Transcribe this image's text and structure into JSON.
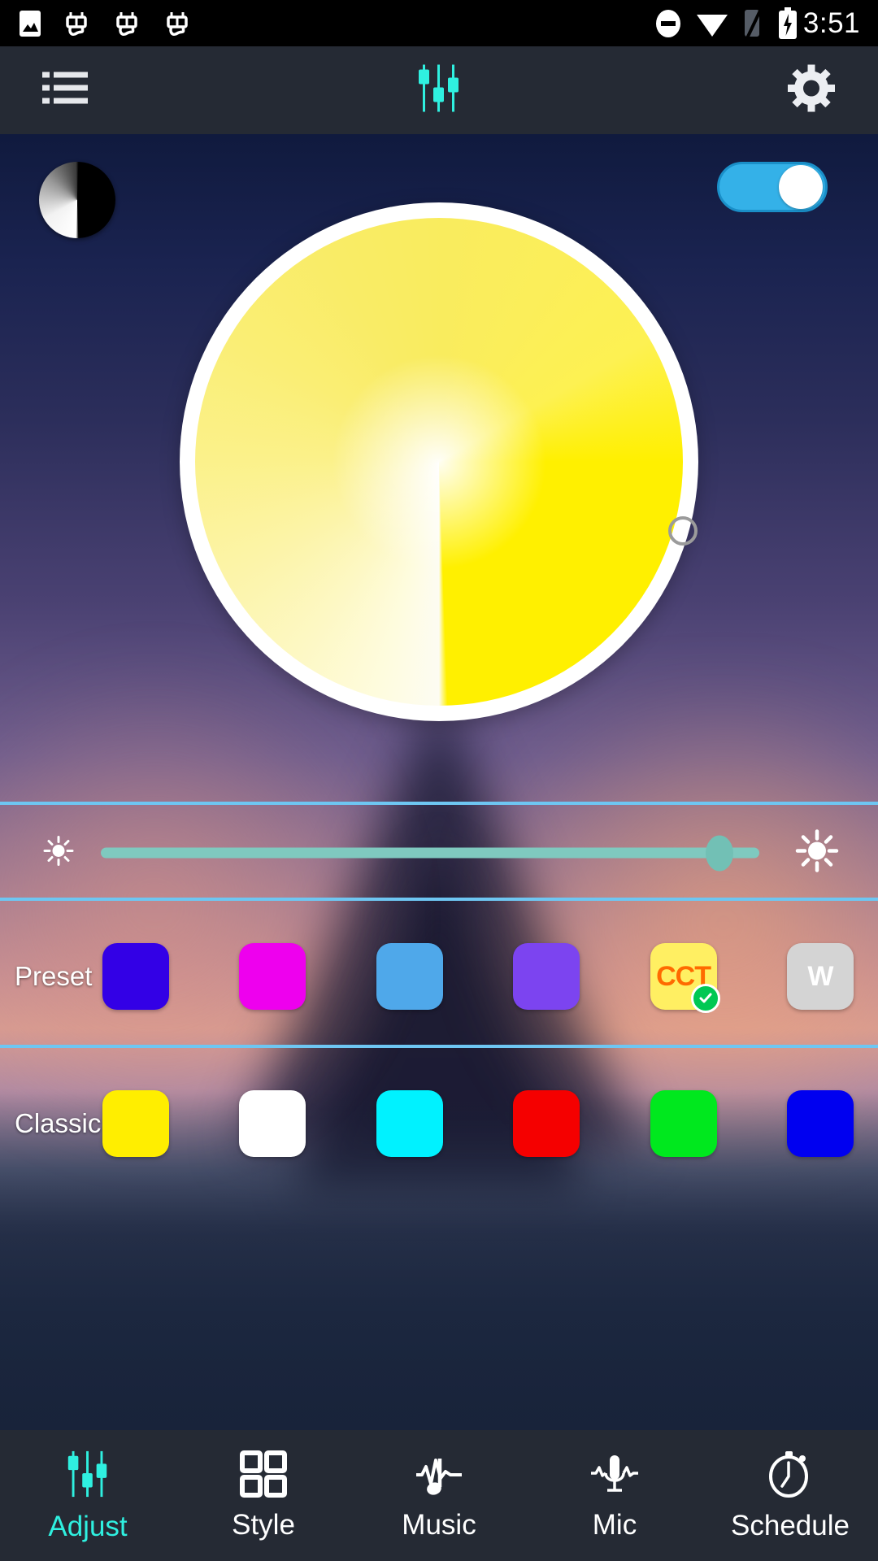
{
  "status_bar": {
    "time": "3:51",
    "left_icons": [
      "image-icon",
      "bug-icon",
      "bug-icon",
      "bug-icon"
    ],
    "right_icons": [
      "do-not-disturb-icon",
      "wifi-icon",
      "signal-off-icon",
      "battery-charging-icon"
    ]
  },
  "app_bar": {
    "menu_icon": "list-menu-icon",
    "title_icon": "sliders-icon",
    "settings_icon": "gear-icon",
    "accent_color": "#2ff0e0"
  },
  "main": {
    "preview_bubble": "color-preview-bubble",
    "power_toggle": {
      "state": "on",
      "track_color": "#34b1e8",
      "knob_color": "#ffffff"
    },
    "color_wheel": {
      "name": "cct-color-wheel",
      "mode": "CCT",
      "hot_color": "#fff000",
      "cool_color": "#ffffff",
      "handle_position": "right",
      "ring_color": "#ffffff"
    },
    "brightness": {
      "min_icon": "sun-small-icon",
      "max_icon": "sun-large-icon",
      "value_percent": 94,
      "track_color": "#7fc9bf",
      "knob_color": "#72c0b5"
    },
    "preset": {
      "label": "Preset",
      "swatches": [
        {
          "name": "preset-blue-violet",
          "color": "#3300e6",
          "text": "",
          "selected": false
        },
        {
          "name": "preset-magenta",
          "color": "#ee00ee",
          "text": "",
          "selected": false
        },
        {
          "name": "preset-light-blue",
          "color": "#4fa8ea",
          "text": "",
          "selected": false
        },
        {
          "name": "preset-purple",
          "color": "#7c44f0",
          "text": "",
          "selected": false
        },
        {
          "name": "preset-cct",
          "color": "#ffef62",
          "text": "CCT",
          "text_color": "#ff6a00",
          "selected": true
        },
        {
          "name": "preset-white",
          "color": "#d4d4d4",
          "text": "W",
          "text_color": "#ffffff",
          "selected": false
        }
      ]
    },
    "classic": {
      "label": "Classic",
      "swatches": [
        {
          "name": "classic-yellow",
          "color": "#ffee00",
          "text": "",
          "selected": false
        },
        {
          "name": "classic-white",
          "color": "#ffffff",
          "text": "",
          "selected": false
        },
        {
          "name": "classic-cyan",
          "color": "#00f2ff",
          "text": "",
          "selected": false
        },
        {
          "name": "classic-red",
          "color": "#f50000",
          "text": "",
          "selected": false
        },
        {
          "name": "classic-green",
          "color": "#00e81e",
          "text": "",
          "selected": false
        },
        {
          "name": "classic-blue",
          "color": "#0000f0",
          "text": "",
          "selected": false
        }
      ]
    },
    "divider_color": "#6ec6f2"
  },
  "bottom_nav": {
    "active": "Adjust",
    "active_color": "#2ff0e0",
    "items": [
      {
        "label": "Adjust",
        "icon": "sliders-icon"
      },
      {
        "label": "Style",
        "icon": "grid-icon"
      },
      {
        "label": "Music",
        "icon": "music-note-icon"
      },
      {
        "label": "Mic",
        "icon": "microphone-icon"
      },
      {
        "label": "Schedule",
        "icon": "stopwatch-icon"
      }
    ]
  }
}
